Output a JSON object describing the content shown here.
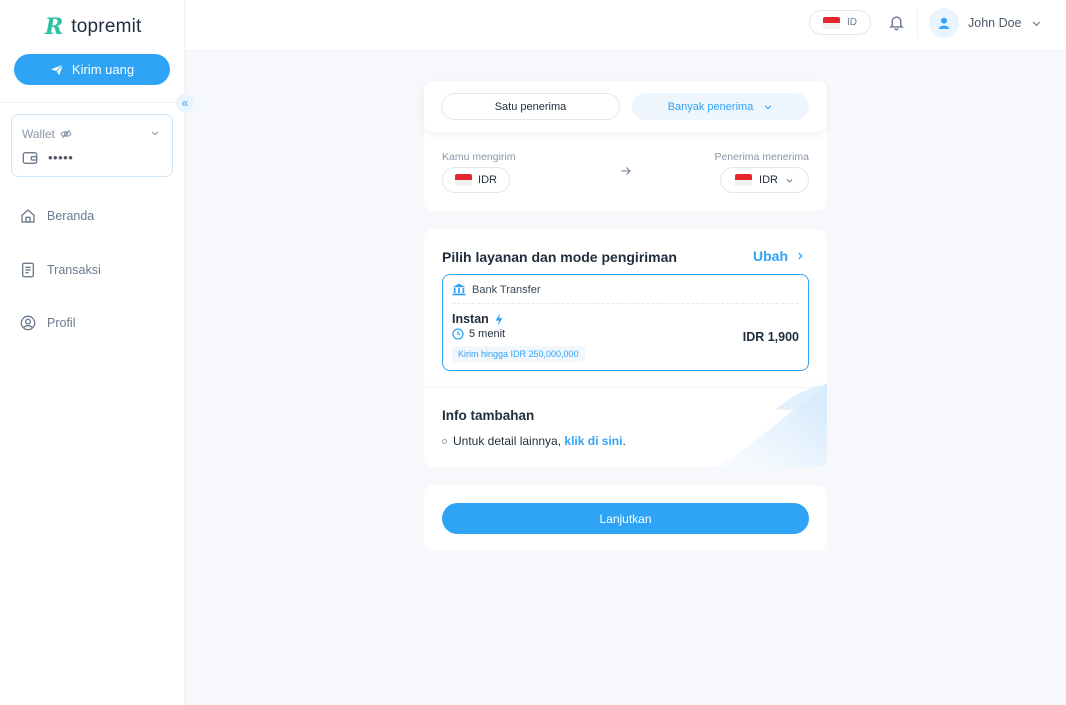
{
  "app": {
    "logo_mark": "R",
    "logo_text": "topremit"
  },
  "sidebar": {
    "send_button": "Kirim uang",
    "wallet": {
      "label": "Wallet",
      "value": "•••••"
    },
    "nav": [
      {
        "label": "Beranda",
        "icon": "home-icon"
      },
      {
        "label": "Transaksi",
        "icon": "receipt-icon"
      },
      {
        "label": "Profil",
        "icon": "user-circle-icon"
      }
    ]
  },
  "topbar": {
    "language": "ID",
    "user_name": "John Doe"
  },
  "recipient": {
    "single": "Satu penerima",
    "multiple": "Banyak penerima"
  },
  "amount": {
    "send_label": "Kamu mengirim",
    "send_currency": "IDR",
    "receive_label": "Penerima menerima",
    "receive_currency": "IDR"
  },
  "service": {
    "title": "Pilih layanan dan mode pengiriman",
    "change": "Ubah",
    "method": "Bank Transfer",
    "mode": "Instan",
    "duration": "5 menit",
    "limit": "Kirim hingga IDR 250,000,000",
    "fee": "IDR 1,900"
  },
  "info": {
    "title": "Info tambahan",
    "text": "Untuk detail lainnya,",
    "link": "klik di sini",
    "suffix": "."
  },
  "actions": {
    "continue": "Lanjutkan"
  },
  "colors": {
    "primary": "#2fa3f5",
    "logo": "#2ac3a2",
    "background": "#f6f8fb"
  }
}
